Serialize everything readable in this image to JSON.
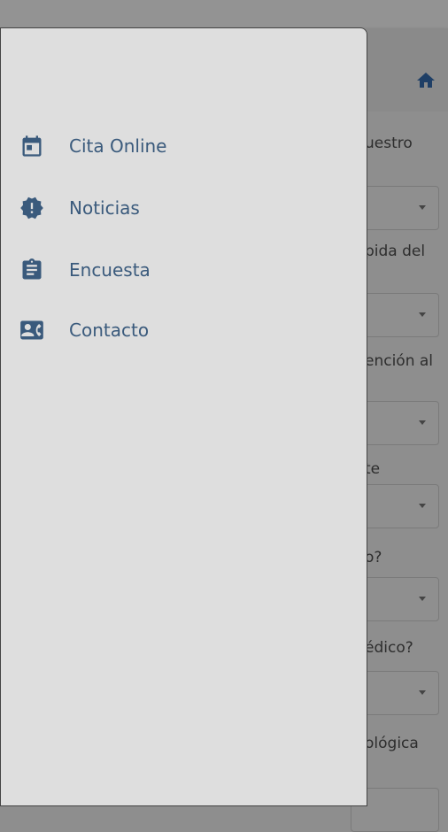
{
  "colors": {
    "accent": "#3a5a7c",
    "drawer_bg": "#dedede"
  },
  "header": {
    "home_icon": "home-icon"
  },
  "drawer": {
    "items": [
      {
        "label": "Cita Online",
        "icon": "calendar-icon"
      },
      {
        "label": "Noticias",
        "icon": "alert-badge-icon"
      },
      {
        "label": "Encuesta",
        "icon": "clipboard-icon"
      },
      {
        "label": "Contacto",
        "icon": "contact-card-icon"
      }
    ]
  },
  "background_form": {
    "questions": [
      "uestro",
      "pida del",
      "ención al",
      "te",
      "o?",
      "édico?",
      "ológica"
    ]
  }
}
